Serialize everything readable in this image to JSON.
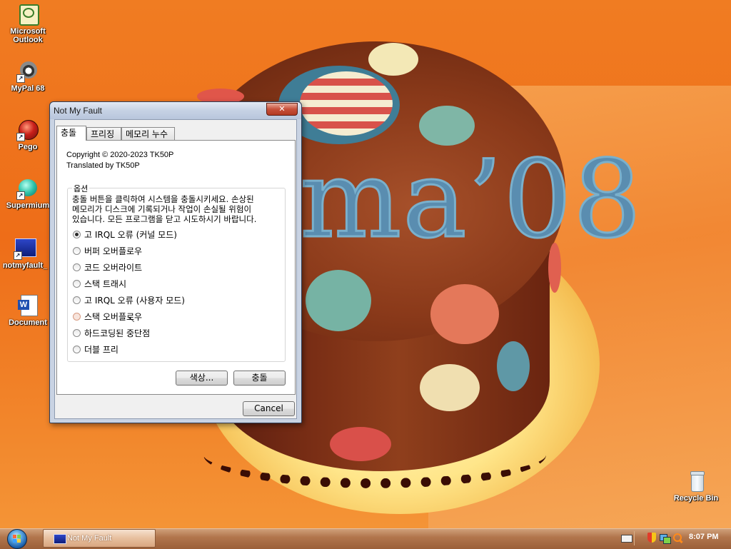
{
  "desktop": {
    "icons": [
      {
        "label_line1": "Microsoft",
        "label_line2": "Outlook",
        "icon": "outlook-icon"
      },
      {
        "label_line1": "MyPal 68",
        "label_line2": "",
        "icon": "mypal-icon"
      },
      {
        "label_line1": "Pego",
        "label_line2": "",
        "icon": "pego-icon"
      },
      {
        "label_line1": "Supermium",
        "label_line2": "",
        "icon": "supermium-icon"
      },
      {
        "label_line1": "notmyfault_",
        "label_line2": "",
        "icon": "notmyfault-icon"
      },
      {
        "label_line1": "Document",
        "label_line2": "",
        "icon": "word-document-icon"
      },
      {
        "label_line1": "Recycle Bin",
        "label_line2": "",
        "icon": "recycle-bin-icon"
      }
    ],
    "wallpaper_text": "ma’08"
  },
  "window": {
    "title": "Not My Fault",
    "close_glyph": "✕",
    "tabs": [
      {
        "label": "충돌",
        "active": true
      },
      {
        "label": "프리징",
        "active": false
      },
      {
        "label": "메모리 누수",
        "active": false
      }
    ],
    "copyright_line": "Copyright © 2020-2023 TK50P",
    "translated_line": "Translated by TK50P",
    "options_group": {
      "label": "옵션",
      "description_line1": "충돌 버튼을 클릭하여 시스템을 충돌시키세요. 손상된",
      "description_line2": "메모리가 디스크에 기록되거나 작업이 손실될 위험이",
      "description_line3": "있습니다. 모든 프로그램을 닫고 시도하시기 바랍니다.",
      "options": [
        {
          "label": "고 IRQL 오류 (커널 모드)",
          "checked": true
        },
        {
          "label": "버퍼 오버플로우",
          "checked": false
        },
        {
          "label": "코드 오버라이트",
          "checked": false
        },
        {
          "label": "스택 트래시",
          "checked": false
        },
        {
          "label": "고 IRQL 오류 (사용자 모드)",
          "checked": false
        },
        {
          "label": "스택 오버플로우",
          "checked": false
        },
        {
          "label": "하드코딩된 중단점",
          "checked": false
        },
        {
          "label": "더블 프리",
          "checked": false
        }
      ]
    },
    "buttons": {
      "color": "색상...",
      "crash": "충돌",
      "cancel": "Cancel"
    }
  },
  "taskbar": {
    "task_label": "Not My Fault",
    "clock": "8:07 PM"
  },
  "colors": {
    "wallpaper_orange": "#ee6d18",
    "taskbar": "#b2764d",
    "window_frame": "#c9d3e3",
    "close_button": "#c7503a"
  }
}
